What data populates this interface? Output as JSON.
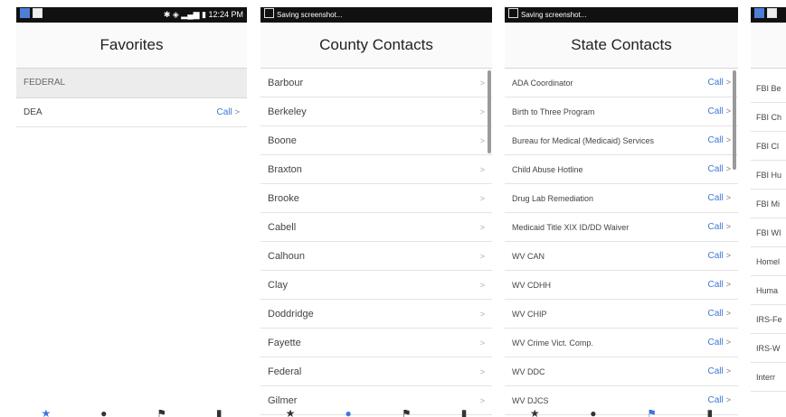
{
  "screen1": {
    "status_time": "12:24 PM",
    "status_icons": "✱ ◈ ▂▄▆ ▮",
    "title": "Favorites",
    "section": "FEDERAL",
    "rows": [
      {
        "label": "DEA",
        "call": "Call",
        "arrow": ">"
      }
    ]
  },
  "screen2": {
    "status_text": "Saving screenshot...",
    "title": "County Contacts",
    "rows": [
      "Barbour",
      "Berkeley",
      "Boone",
      "Braxton",
      "Brooke",
      "Cabell",
      "Calhoun",
      "Clay",
      "Doddridge",
      "Fayette",
      "Federal",
      "Gilmer"
    ],
    "chevron": ">"
  },
  "screen3": {
    "status_text": "Saving screenshot...",
    "title": "State Contacts",
    "call_label": "Call",
    "arrow": ">",
    "rows": [
      "ADA Coordinator",
      "Birth to Three Program",
      "Bureau for Medical (Medicaid) Services",
      "Child Abuse Hotline",
      "Drug Lab Remediation",
      "Medicaid Title XIX ID/DD Waiver",
      "WV CAN",
      "WV CDHH",
      "WV CHIP",
      "WV Crime Vict. Comp.",
      "WV DDC",
      "WV DJCS"
    ]
  },
  "screen4": {
    "rows": [
      "FBI Be",
      "FBI Ch",
      "FBI Cl",
      "FBI Hu",
      "FBI Mi",
      "FBI WI",
      "Homel",
      "Huma",
      "IRS-Fe",
      "IRS-W",
      "Interr"
    ]
  },
  "nav": {
    "favorites_icon": "★",
    "person_icon": "●",
    "flag_icon": "⚑",
    "building_icon": "▮"
  },
  "colors": {
    "accent": "#3b78d8",
    "status_bar": "#111111",
    "section_bg": "#ececec"
  }
}
